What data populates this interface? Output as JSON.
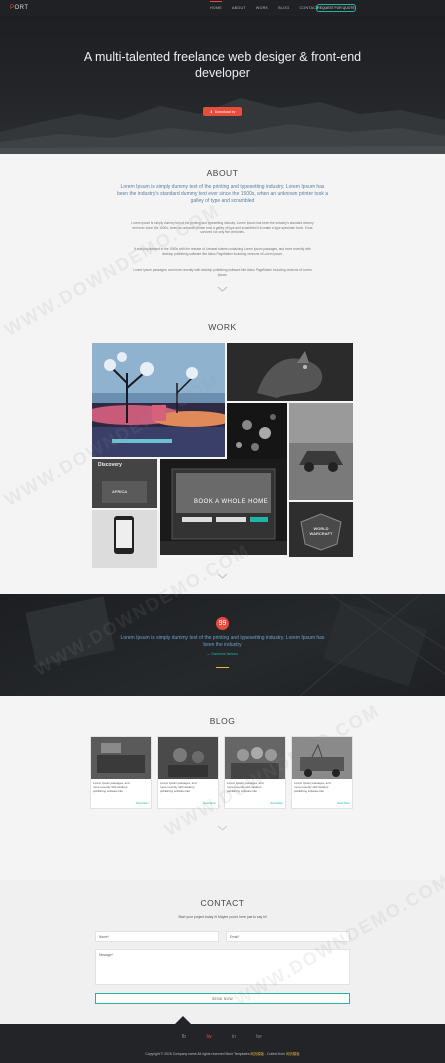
{
  "nav": {
    "logo_a": "P",
    "logo_b": "ORT",
    "items": [
      "HOME",
      "ABOUT",
      "WORK",
      "BLOG",
      "CONTACT"
    ],
    "active": "HOME",
    "quote_button": "REQUEST FOR QUOTE"
  },
  "hero": {
    "title": "A multi-talented freelance web desiger & front-end developer",
    "download_label": "Download cv"
  },
  "about": {
    "title": "ABOUT",
    "lead": "Lorem Ipsum is simply dummy text of the printing and typesetting industry. Lorem Ipsum has been the industry's standard dummy text ever since the 1500s, when an unknown printer took a galley of type and scrambled",
    "p1": "Lorem Ipsum is simply dummy text of the printing and typesetting industry. Lorem Ipsum has been the industry's standard dummy text ever since the 1500s, when an unknown printer took a galley of type and scrambled it to make a type specimen book. It has survived not only five centuries.",
    "p2": "It was popularised in the 1960s with the release of Letraset sheets containing Lorem Ipsum passages, and more recently with desktop publishing software like Aldus PageMaker including versions of Lorem Ipsum.",
    "p3": "Lorem Ipsum passages, and more recently with desktop publishing software like Aldus PageMaker including versions of Lorem Ipsum."
  },
  "work": {
    "title": "WORK",
    "tile_discovery": "Discovery",
    "tile_africa": "AFRICA",
    "tile_book": "BOOK A WHOLE HOME",
    "tile_warcraft": "WORLD WARCRAFT"
  },
  "quote": {
    "icon": "99",
    "text": "Lorem Ipsum is simply dummy text of the printing and typesetting industry. Lorem Ipsum has been the industry",
    "author": "— Someone famous"
  },
  "blog": {
    "title": "BLOG",
    "posts": [
      {
        "text": "Lorem Ipsum passages, and more recently with desktop publishing software like",
        "more": "Read More"
      },
      {
        "text": "Lorem Ipsum passages, and more recently with desktop publishing software like",
        "more": "Read More"
      },
      {
        "text": "Lorem Ipsum passages, and more recently with desktop publishing software like",
        "more": "Read More"
      },
      {
        "text": "Lorem Ipsum passages, and more recently with desktop publishing software like",
        "more": "Read More"
      }
    ]
  },
  "contact": {
    "title": "CONTACT",
    "subtitle": "Start your project today ✉ Maybe you're here just to say hi!",
    "name_placeholder": "Name*",
    "email_placeholder": "Email*",
    "message_placeholder": "Message*",
    "send_label": "SEND NOW"
  },
  "footer": {
    "socials": [
      "fb",
      "tw",
      "in",
      "be"
    ],
    "copy_a": "Copyright © 2015 Company name All rights reserved ",
    "copy_b": "More Templates ",
    "copy_c": "网页模板",
    "copy_d": " - Collect from ",
    "copy_e": "网页模板"
  },
  "watermark": "WWW.DOWNDEMO.COM",
  "colors": {
    "accent": "#e74c3c",
    "teal": "#1fb5a8",
    "dark": "#1f2124"
  }
}
